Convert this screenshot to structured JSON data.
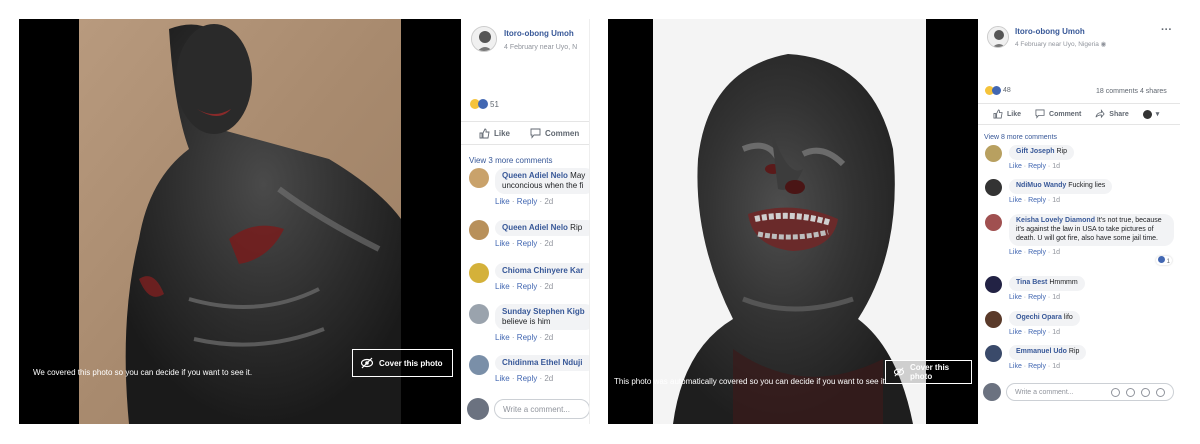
{
  "left": {
    "cover_caption": "We covered this photo so you can decide if you want to see it.",
    "cover_button": "Cover this photo",
    "author": "Itoro-obong Umoh",
    "meta": "4 February near Uyo, N",
    "reaction_count": "51",
    "like": "Like",
    "comment": "Commen",
    "view_more": "View 3 more comments",
    "comments": [
      {
        "author": "Queen Adiel Nelo",
        "text": "May",
        "text2": "unconcious when the fi",
        "like": "Like",
        "reply": "Reply",
        "time": "2d",
        "color": "#c9a26b"
      },
      {
        "author": "Queen Adiel Nelo",
        "text": "Rip",
        "text2": "",
        "like": "Like",
        "reply": "Reply",
        "time": "2d",
        "color": "#b8905a"
      },
      {
        "author": "Chioma Chinyere Kar",
        "text": "",
        "text2": "",
        "like": "Like",
        "reply": "Reply",
        "time": "2d",
        "color": "#d4b13a"
      },
      {
        "author": "Sunday Stephen Kigb",
        "text": "",
        "text2": "believe is him",
        "like": "Like",
        "reply": "Reply",
        "time": "2d",
        "color": "#9aa3ad"
      },
      {
        "author": "Chidinma Ethel Nduji",
        "text": "",
        "text2": "",
        "like": "Like",
        "reply": "Reply",
        "time": "2d",
        "color": "#7a8fa8"
      }
    ],
    "write_placeholder": "Write a comment..."
  },
  "right": {
    "cover_caption": "This photo was automatically covered so you can decide if you want to see it.",
    "cover_button": "Cover this photo",
    "author": "Itoro-obong Umoh",
    "meta": "4 February near Uyo, Nigeria",
    "reaction_count": "48",
    "stats": "18 comments  4 shares",
    "like": "Like",
    "comment": "Comment",
    "share": "Share",
    "more": "···",
    "view_more": "View 8 more comments",
    "comments": [
      {
        "author": "Gift Joseph",
        "text": "Rip",
        "like": "Like",
        "reply": "Reply",
        "time": "1d",
        "color": "#b8a060"
      },
      {
        "author": "NdiMuo Wandy",
        "text": "Fucking lies",
        "like": "Like",
        "reply": "Reply",
        "time": "1d",
        "color": "#333333"
      },
      {
        "author": "Keisha Lovely Diamond",
        "text": "It's not true, because it's against the law in USA to take pictures of death. U will got fire, also have some jail time.",
        "like": "Like",
        "reply": "Reply",
        "time": "1d",
        "color": "#a05050",
        "badge": "1"
      },
      {
        "author": "Tina Best",
        "text": "Hmmmm",
        "like": "Like",
        "reply": "Reply",
        "time": "1d",
        "color": "#222244"
      },
      {
        "author": "Ogechi Opara",
        "text": "lifo",
        "like": "Like",
        "reply": "Reply",
        "time": "1d",
        "color": "#5a3a2a"
      },
      {
        "author": "Emmanuel Udo",
        "text": "Rip",
        "like": "Like",
        "reply": "Reply",
        "time": "1d",
        "color": "#3a4a6a"
      }
    ],
    "write_placeholder": "Write a comment..."
  },
  "colors": {
    "link": "#385898",
    "like_blue": "#4267b2",
    "muted": "#90949c",
    "bubble": "#f2f3f5",
    "sad_yellow": "#f5c33b"
  }
}
